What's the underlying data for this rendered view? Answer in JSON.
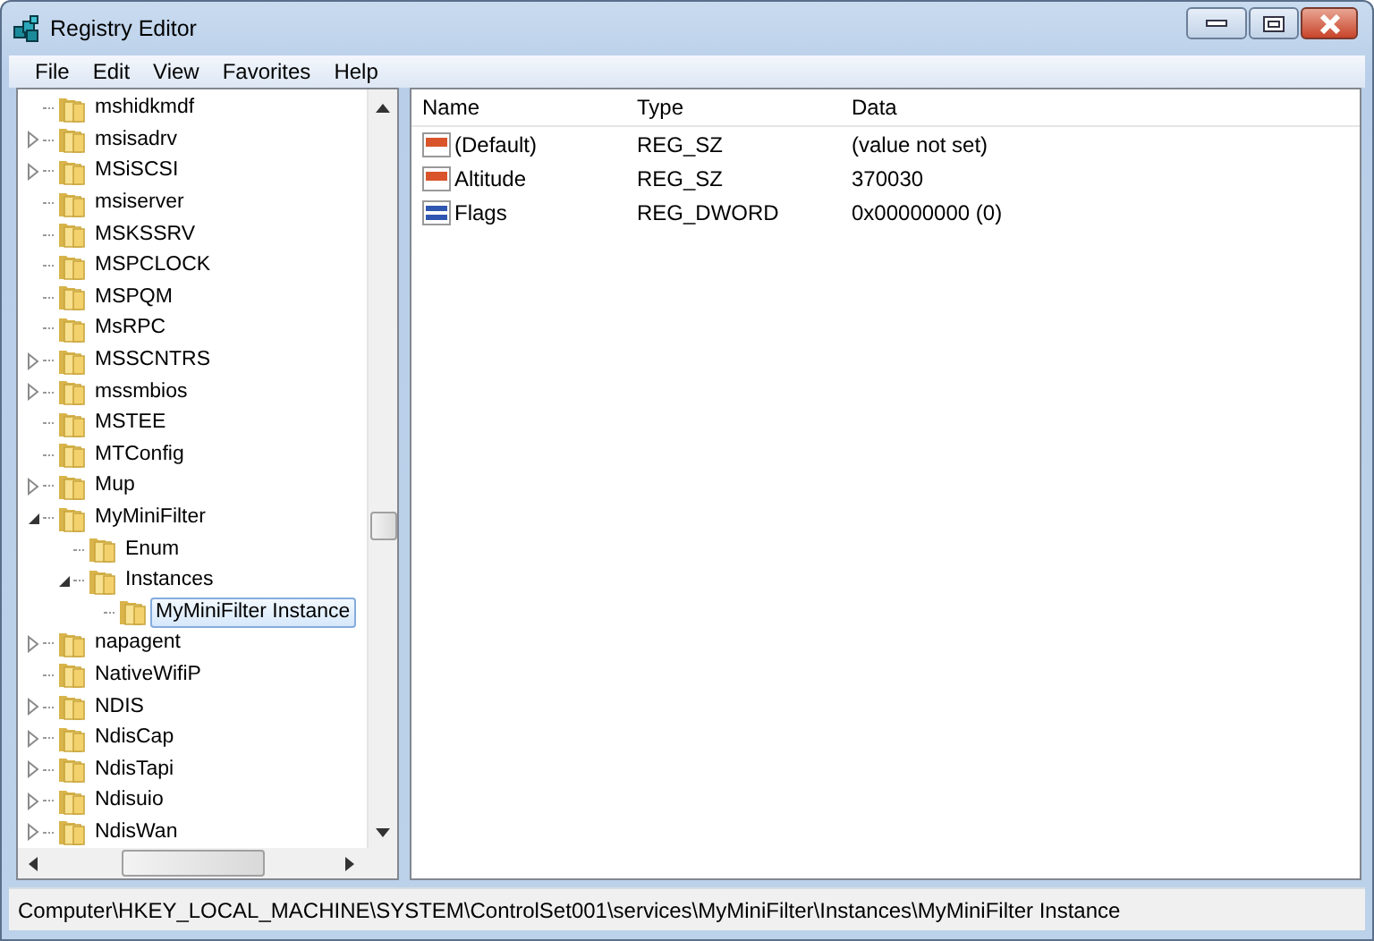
{
  "window": {
    "title": "Registry Editor"
  },
  "menu": [
    "File",
    "Edit",
    "View",
    "Favorites",
    "Help"
  ],
  "tree": [
    {
      "label": "mshidkmdf",
      "kind": "leaf",
      "selected": false
    },
    {
      "label": "msisadrv",
      "kind": "collapsed",
      "selected": false
    },
    {
      "label": "MSiSCSI",
      "kind": "collapsed",
      "selected": false
    },
    {
      "label": "msiserver",
      "kind": "leaf",
      "selected": false
    },
    {
      "label": "MSKSSRV",
      "kind": "leaf",
      "selected": false
    },
    {
      "label": "MSPCLOCK",
      "kind": "leaf",
      "selected": false
    },
    {
      "label": "MSPQM",
      "kind": "leaf",
      "selected": false
    },
    {
      "label": "MsRPC",
      "kind": "leaf",
      "selected": false
    },
    {
      "label": "MSSCNTRS",
      "kind": "collapsed",
      "selected": false
    },
    {
      "label": "mssmbios",
      "kind": "collapsed",
      "selected": false
    },
    {
      "label": "MSTEE",
      "kind": "leaf",
      "selected": false
    },
    {
      "label": "MTConfig",
      "kind": "leaf",
      "selected": false
    },
    {
      "label": "Mup",
      "kind": "collapsed",
      "selected": false
    },
    {
      "label": "MyMiniFilter",
      "kind": "expanded",
      "selected": false,
      "children": [
        {
          "label": "Enum",
          "kind": "leaf",
          "selected": false
        },
        {
          "label": "Instances",
          "kind": "expanded",
          "selected": false,
          "children": [
            {
              "label": "MyMiniFilter Instance",
              "kind": "leaf",
              "selected": true
            }
          ]
        }
      ]
    },
    {
      "label": "napagent",
      "kind": "collapsed",
      "selected": false
    },
    {
      "label": "NativeWifiP",
      "kind": "leaf",
      "selected": false
    },
    {
      "label": "NDIS",
      "kind": "collapsed",
      "selected": false
    },
    {
      "label": "NdisCap",
      "kind": "collapsed",
      "selected": false
    },
    {
      "label": "NdisTapi",
      "kind": "collapsed",
      "selected": false
    },
    {
      "label": "Ndisuio",
      "kind": "collapsed",
      "selected": false
    },
    {
      "label": "NdisWan",
      "kind": "collapsed",
      "selected": false
    }
  ],
  "values": {
    "columns": [
      "Name",
      "Type",
      "Data"
    ],
    "rows": [
      {
        "kind": "string",
        "name": "(Default)",
        "type": "REG_SZ",
        "data": "(value not set)"
      },
      {
        "kind": "string",
        "name": "Altitude",
        "type": "REG_SZ",
        "data": "370030"
      },
      {
        "kind": "dword",
        "name": "Flags",
        "type": "REG_DWORD",
        "data": "0x00000000 (0)"
      }
    ]
  },
  "status_bar": "Computer\\HKEY_LOCAL_MACHINE\\SYSTEM\\ControlSet001\\services\\MyMiniFilter\\Instances\\MyMiniFilter Instance"
}
